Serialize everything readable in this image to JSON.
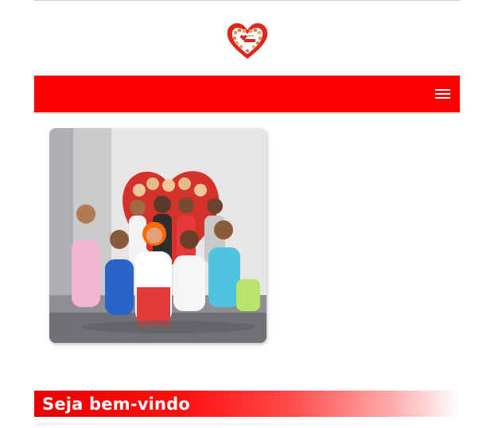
{
  "header": {
    "logo": {
      "icon": "heart-logo",
      "color": "#e2241b"
    }
  },
  "navbar": {
    "color": "#ff0000",
    "menu_icon": "hamburger-menu-icon"
  },
  "gallery": {
    "photo": {
      "subject": "group-photo"
    }
  },
  "welcome": {
    "title": "Seja bem-vindo",
    "gradient_color": "#ff0000"
  }
}
